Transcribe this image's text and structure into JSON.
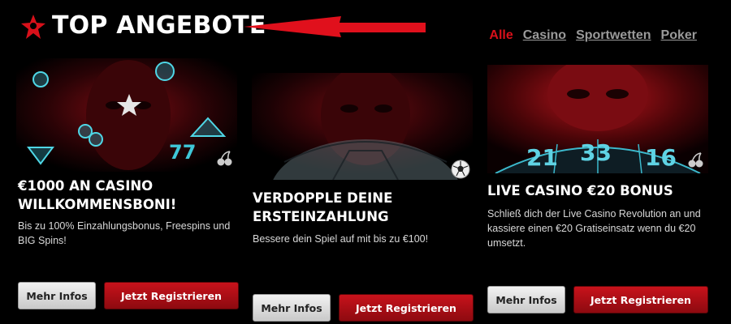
{
  "header": {
    "title": "TOP ANGEBOTE",
    "logo_icon": "star-logo-icon",
    "arrow_icon": "red-arrow-left-icon",
    "accent_color": "#d8101a"
  },
  "filters": {
    "items": [
      {
        "label": "Alle",
        "active": true
      },
      {
        "label": "Casino",
        "active": false
      },
      {
        "label": "Sportwetten",
        "active": false
      },
      {
        "label": "Poker",
        "active": false
      }
    ]
  },
  "cards": [
    {
      "title": "€1000 AN CASINO\nWILLKOMMENSBONI!",
      "description": "Bis zu 100% Einzahlungsbonus, Freespins und BIG Spins!",
      "corner_icon": "cherries-icon",
      "more_label": "Mehr Infos",
      "register_label": "Jetzt Registrieren"
    },
    {
      "title": "VERDOPPLE DEINE\nERSTEINZAHLUNG",
      "description": "Bessere dein Spiel auf mit bis zu €100!",
      "corner_icon": "soccer-ball-icon",
      "more_label": "Mehr Infos",
      "register_label": "Jetzt Registrieren"
    },
    {
      "title": "LIVE CASINO €20 BONUS",
      "description": "Schließ dich der Live Casino Revolution an und kassiere einen €20 Gratiseinsatz wenn du €20 umsetzt.",
      "corner_icon": "cherries-icon",
      "roulette_numbers": [
        "21",
        "33",
        "16"
      ],
      "more_label": "Mehr Infos",
      "register_label": "Jetzt Registrieren"
    }
  ]
}
